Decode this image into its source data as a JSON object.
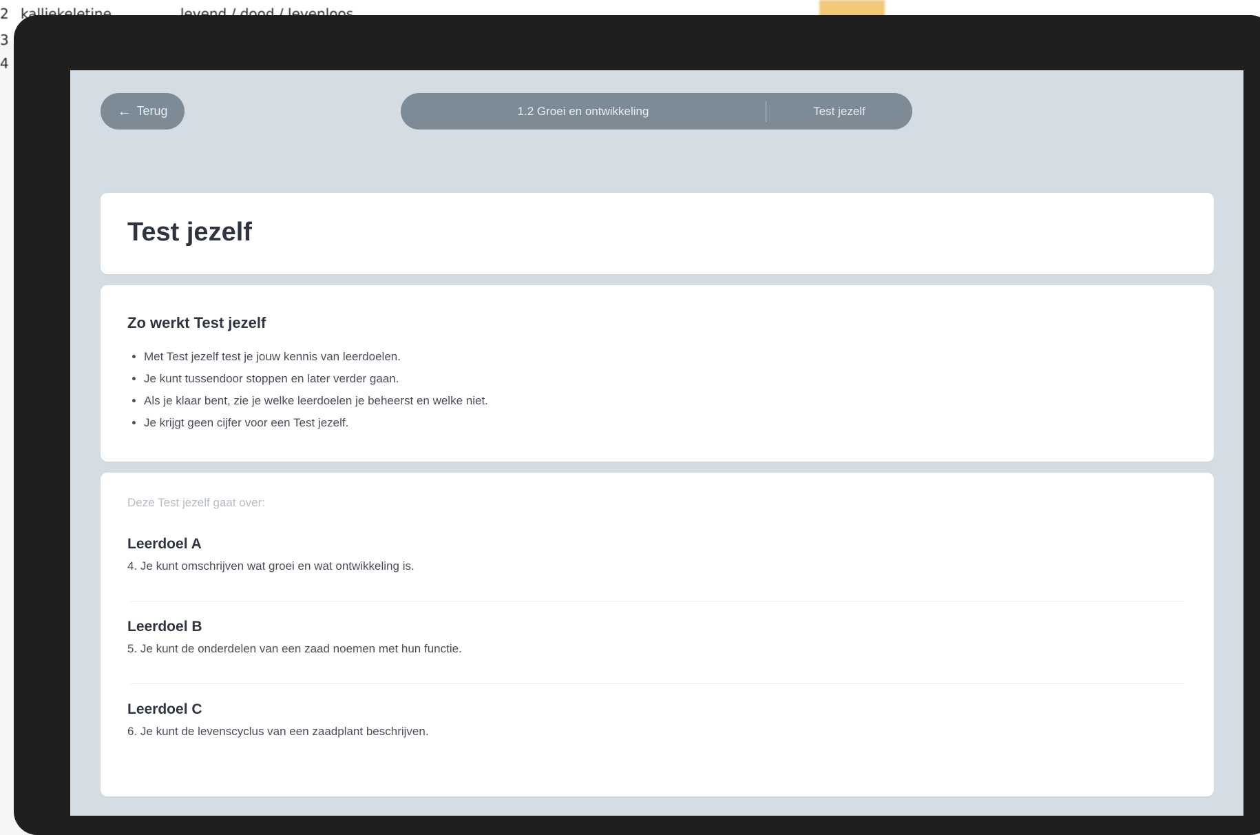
{
  "background": {
    "lines": [
      {
        "num": "2",
        "text": "kalliekeletine",
        "text2": "levend / dood / levenloos"
      },
      {
        "num": "3",
        "text": ""
      },
      {
        "num": "4",
        "text": ""
      }
    ],
    "accent_color": "#f1c77a"
  },
  "header": {
    "back_icon": "arrow-left-icon",
    "back_label": "Terug",
    "breadcrumb_section": "1.2 Groei en ontwikkeling",
    "breadcrumb_page": "Test jezelf"
  },
  "title": "Test jezelf",
  "info": {
    "heading": "Zo werkt Test jezelf",
    "bullets": [
      "Met Test jezelf test je jouw kennis van leerdoelen.",
      "Je kunt tussendoor stoppen en later verder gaan.",
      "Als je klaar bent, zie je welke leerdoelen je beheerst en welke niet.",
      "Je krijgt geen cijfer voor een Test jezelf."
    ]
  },
  "goals": {
    "intro": "Deze Test jezelf gaat over:",
    "items": [
      {
        "name": "Leerdoel A",
        "description": "4. Je kunt omschrijven wat groei en wat ontwikkeling is."
      },
      {
        "name": "Leerdoel B",
        "description": "5. Je kunt de onderdelen van een zaad noemen met hun functie."
      },
      {
        "name": "Leerdoel C",
        "description": "6. Je kunt de levenscyclus van een zaadplant beschrijven."
      }
    ]
  },
  "colors": {
    "frame": "#1f1f1f",
    "screen": "#d3dde3",
    "pill": "#7c8b96",
    "card": "#ffffff",
    "title_text": "#2e3440"
  }
}
